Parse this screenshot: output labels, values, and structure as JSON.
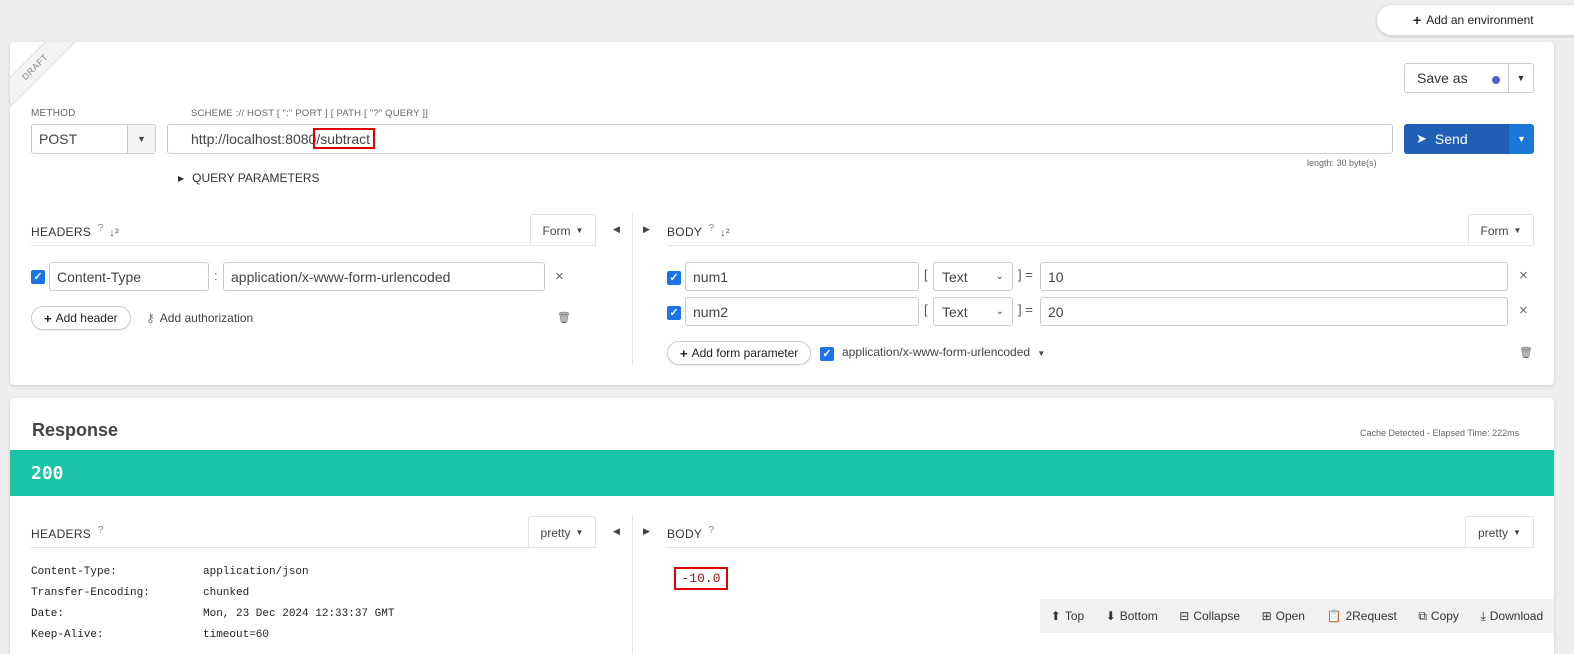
{
  "top": {
    "add_env_label": "Add an environment"
  },
  "request": {
    "draft_label": "DRAFT",
    "method_label": "METHOD",
    "method_value": "POST",
    "scheme_label": "SCHEME :// HOST [ \":\" PORT ] [ PATH [ \"?\" QUERY ]]",
    "url_base": "http://localhost:8080",
    "url_path": "/subtract",
    "length_text": "length: 30 byte(s)",
    "query_params_label": "QUERY PARAMETERS",
    "save_as_label": "Save as",
    "send_label": "Send",
    "headers": {
      "title": "HEADERS",
      "mode": "Form",
      "key": "Content-Type",
      "value": "application/x-www-form-urlencoded",
      "add_header_label": "Add header",
      "add_auth_label": "Add authorization"
    },
    "body": {
      "title": "BODY",
      "mode": "Form",
      "params": [
        {
          "name": "num1",
          "type": "Text",
          "value": "10"
        },
        {
          "name": "num2",
          "type": "Text",
          "value": "20"
        }
      ],
      "add_param_label": "Add form parameter",
      "content_type": "application/x-www-form-urlencoded"
    }
  },
  "response": {
    "title": "Response",
    "meta": "Cache Detected - Elapsed Time: 222ms",
    "status": "200",
    "headers": {
      "title": "HEADERS",
      "mode": "pretty",
      "rows": [
        {
          "k": "Content-Type:",
          "v": "application/json"
        },
        {
          "k": "Transfer-Encoding:",
          "v": "chunked"
        },
        {
          "k": "Date:",
          "v": "Mon, 23 Dec 2024 12:33:37 GMT"
        },
        {
          "k": "Keep-Alive:",
          "v": "timeout=60"
        }
      ]
    },
    "body": {
      "title": "BODY",
      "mode": "pretty",
      "value": "-10.0"
    },
    "toolbar": {
      "top": "Top",
      "bottom": "Bottom",
      "collapse": "Collapse",
      "open": "Open",
      "to_request": "2Request",
      "copy": "Copy",
      "download": "Download"
    }
  },
  "colors": {
    "status_bar": "#1bc4a6",
    "send": "#1f5fb8",
    "send_toggle": "#1d77d6",
    "checkbox": "#1a73e8",
    "highlight": "#e00000"
  }
}
